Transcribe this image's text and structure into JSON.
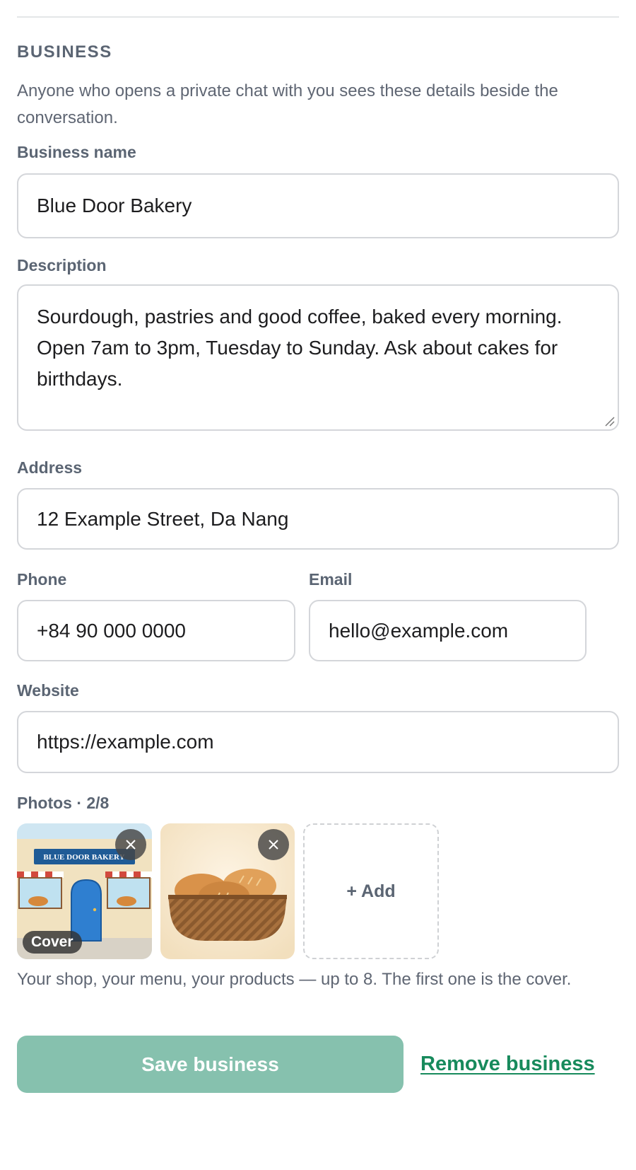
{
  "section": {
    "title": "BUSINESS",
    "description": "Anyone who opens a private chat with you sees these details beside the conversation."
  },
  "fields": {
    "business_name": {
      "label": "Business name",
      "value": "Blue Door Bakery"
    },
    "description": {
      "label": "Description",
      "value": "Sourdough, pastries and good coffee, baked every morning. Open 7am to 3pm, Tuesday to Sunday. Ask about cakes for birthdays."
    },
    "address": {
      "label": "Address",
      "value": "12 Example Street, Da Nang"
    },
    "phone": {
      "label": "Phone",
      "value": "+84 90 000 0000"
    },
    "email": {
      "label": "Email",
      "value": "hello@example.com"
    },
    "website": {
      "label": "Website",
      "value": "https://example.com"
    }
  },
  "photos": {
    "label": "Photos · 2/8",
    "items": [
      {
        "icon": "shopfront-image",
        "sign_text": "BLUE DOOR BAKERY",
        "badge": "Cover"
      },
      {
        "icon": "bread-basket-image"
      }
    ],
    "add_label": "+ Add",
    "hint": "Your shop, your menu, your products — up to 8. The first one is the cover."
  },
  "actions": {
    "save_label": "Save business",
    "remove_label": "Remove business"
  },
  "colors": {
    "accent": "#178a5c",
    "save_button_disabled": "#86c1ae",
    "label": "#5b6573"
  }
}
